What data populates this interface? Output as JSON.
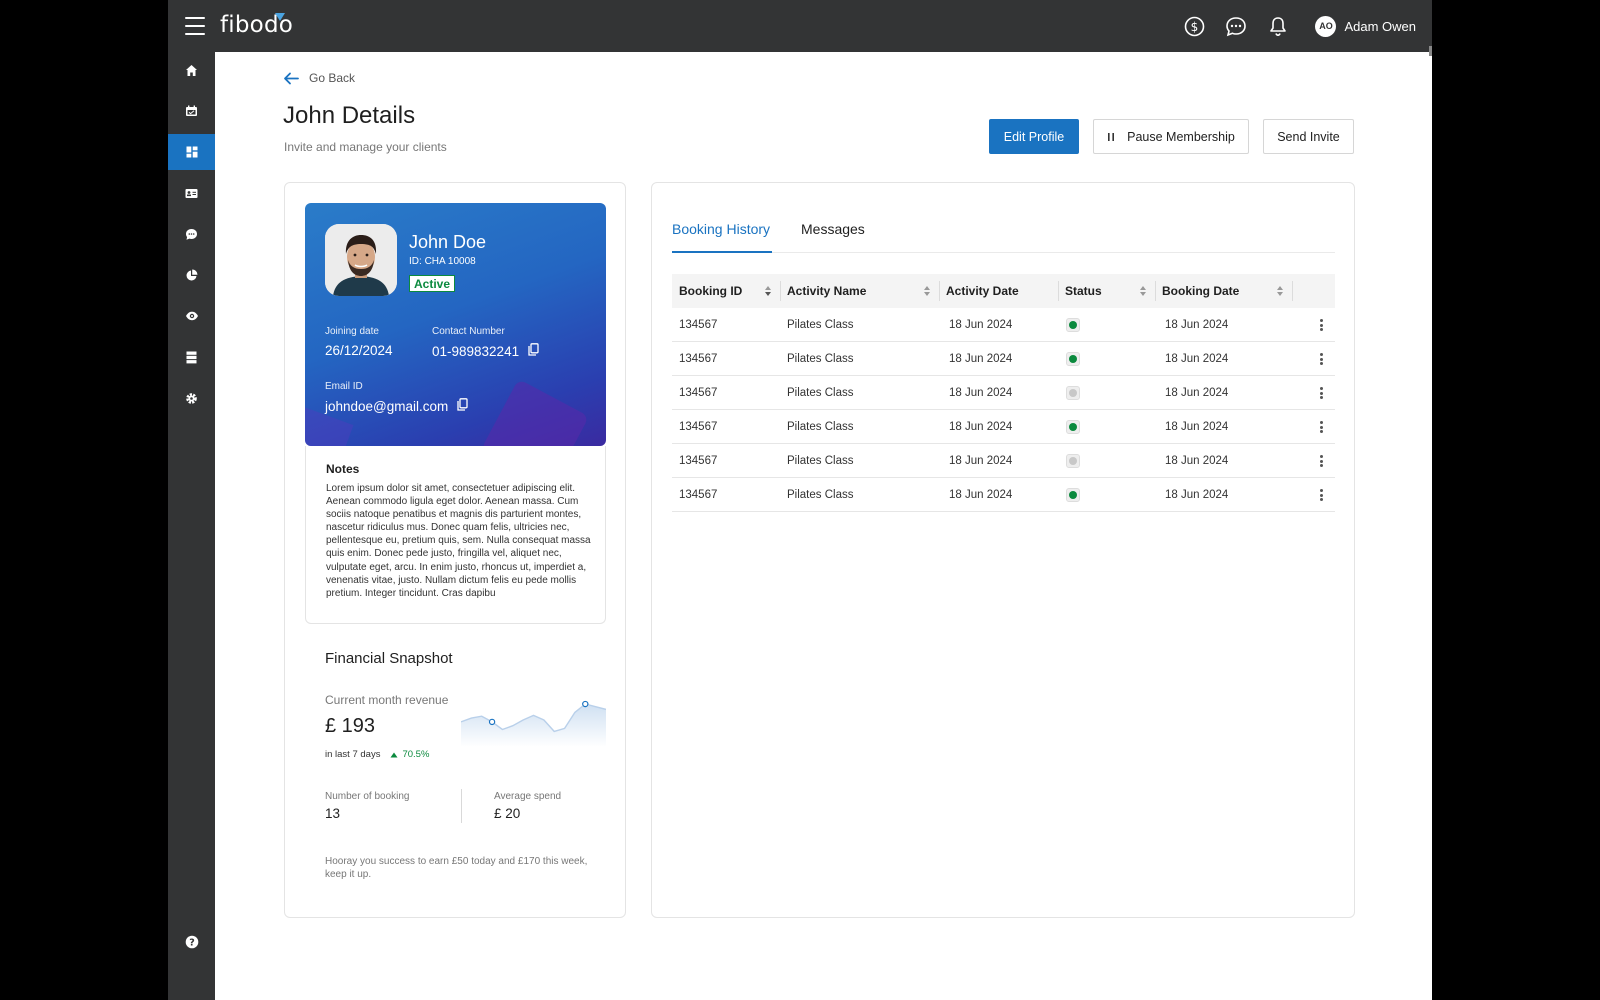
{
  "app": {
    "logo": "fibodo",
    "user_initials": "AO",
    "user_name": "Adam Owen"
  },
  "colors": {
    "accent": "#1a73c1",
    "status_active": "#0b8a3e",
    "status_inactive": "#c8c8c8",
    "chrome": "#333435"
  },
  "topbar_icons": [
    "dollar-icon",
    "chat-icon",
    "bell-icon"
  ],
  "sidebar": {
    "items": [
      {
        "name": "home-icon",
        "active": false
      },
      {
        "name": "calendar-icon",
        "active": false
      },
      {
        "name": "dashboard-icon",
        "active": true
      },
      {
        "name": "id-card-icon",
        "active": false
      },
      {
        "name": "messages-icon",
        "active": false
      },
      {
        "name": "pie-chart-icon",
        "active": false
      },
      {
        "name": "eye-icon",
        "active": false
      },
      {
        "name": "list-icon",
        "active": false
      },
      {
        "name": "settings-icon",
        "active": false
      }
    ],
    "help_icon": "help-icon"
  },
  "page": {
    "back_label": "Go Back",
    "title": "John Details",
    "subtitle": "Invite and manage your clients"
  },
  "actions": {
    "edit_profile": "Edit Profile",
    "pause_membership": "Pause Membership",
    "send_invite": "Send Invite"
  },
  "client": {
    "name": "John Doe",
    "id_label": "ID:",
    "id_value": "CHA 10008",
    "status": "Active",
    "joining_label": "Joining date",
    "joining_value": "26/12/2024",
    "contact_label": "Contact Number",
    "contact_value": "01-989832241",
    "email_label": "Email ID",
    "email_value": "johndoe@gmail.com"
  },
  "notes": {
    "title": "Notes",
    "text": "Lorem ipsum dolor sit amet, consectetuer adipiscing elit. Aenean commodo ligula eget dolor. Aenean massa. Cum sociis natoque penatibus et magnis dis parturient montes, nascetur ridiculus mus. Donec quam felis, ultricies nec, pellentesque eu, pretium quis, sem. Nulla consequat massa quis enim. Donec pede justo, fringilla vel, aliquet nec, vulputate eget, arcu. In enim justo, rhoncus ut, imperdiet a, venenatis vitae, justo. Nullam dictum felis eu pede mollis pretium. Integer tincidunt. Cras dapibu"
  },
  "financial": {
    "title": "Financial Snapshot",
    "revenue_label": "Current month revenue",
    "revenue_value": "£ 193",
    "period_label": "in last 7 days",
    "change_value": "70.5%",
    "bookings_label": "Number of booking",
    "bookings_value": "13",
    "avg_spend_label": "Average spend",
    "avg_spend_value": "£ 20",
    "message": "Hooray you success to earn £50 today and £170 this week, keep it up.",
    "sparkline": [
      0.45,
      0.55,
      0.6,
      0.45,
      0.25,
      0.35,
      0.5,
      0.62,
      0.5,
      0.2,
      0.28,
      0.7,
      0.92,
      0.85,
      0.78
    ]
  },
  "tabs": [
    {
      "label": "Booking History",
      "active": true
    },
    {
      "label": "Messages",
      "active": false
    }
  ],
  "table": {
    "columns": [
      "Booking ID",
      "Activity Name",
      "Activity Date",
      "Status",
      "Booking Date"
    ],
    "rows": [
      {
        "booking_id": "134567",
        "activity": "Pilates Class",
        "activity_date": "18 Jun 2024",
        "status": "active",
        "booking_date": "18 Jun 2024"
      },
      {
        "booking_id": "134567",
        "activity": "Pilates Class",
        "activity_date": "18 Jun 2024",
        "status": "active",
        "booking_date": "18 Jun 2024"
      },
      {
        "booking_id": "134567",
        "activity": "Pilates Class",
        "activity_date": "18 Jun 2024",
        "status": "inactive",
        "booking_date": "18 Jun 2024"
      },
      {
        "booking_id": "134567",
        "activity": "Pilates Class",
        "activity_date": "18 Jun 2024",
        "status": "active",
        "booking_date": "18 Jun 2024"
      },
      {
        "booking_id": "134567",
        "activity": "Pilates Class",
        "activity_date": "18 Jun 2024",
        "status": "inactive",
        "booking_date": "18 Jun 2024"
      },
      {
        "booking_id": "134567",
        "activity": "Pilates Class",
        "activity_date": "18 Jun 2024",
        "status": "active",
        "booking_date": "18 Jun 2024"
      }
    ]
  }
}
